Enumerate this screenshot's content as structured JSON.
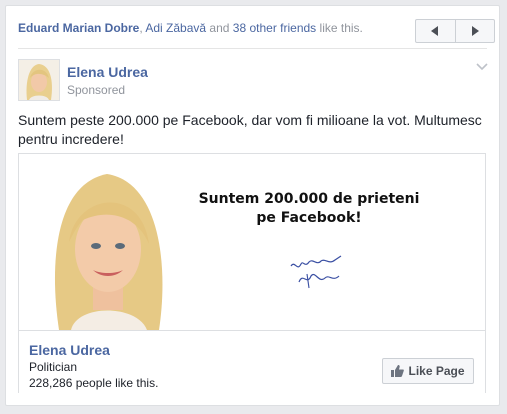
{
  "social_context": {
    "friend_1": "Eduard Marian Dobre",
    "separator": ",",
    "friend_2": "Adi Zăbavă",
    "and_text": "and",
    "others": "38 other friends",
    "suffix": "like this."
  },
  "pager": {
    "prev_icon": "chevron-left-icon",
    "next_icon": "chevron-right-icon"
  },
  "post": {
    "page_name": "Elena Udrea",
    "sponsored_label": "Sponsored",
    "message": "Suntem peste 200.000 pe Facebook, dar vom fi milioane la vot. Multumesc pentru incredere!"
  },
  "ad": {
    "headline": "Suntem 200.000 de prieteni pe Facebook!",
    "page_name": "Elena Udrea",
    "category": "Politician",
    "likes_text": "228,286 people like this.",
    "like_button_label": "Like Page"
  },
  "colors": {
    "link": "#4b67a1",
    "background": "#e9eaed",
    "border": "#dddfe2",
    "muted_text": "#90949c"
  }
}
